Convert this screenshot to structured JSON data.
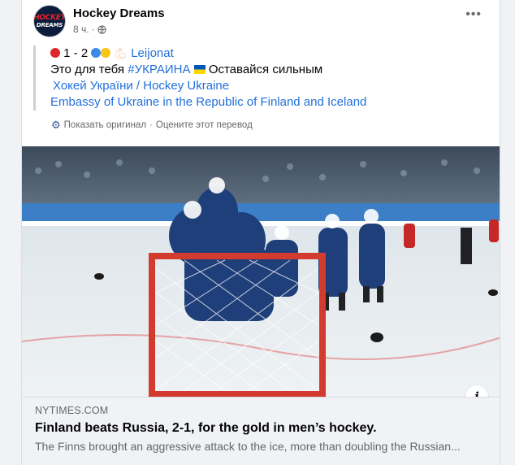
{
  "post": {
    "author": "Hockey Dreams",
    "time": "8 ч.",
    "separator": "·",
    "avatar_text_top": "HOCKEY",
    "avatar_text_bottom": "DREAMS",
    "more_icon": "•••"
  },
  "body": {
    "score_text": "1 - 2",
    "team_tag": "Leijonat",
    "line2_prefix": "Это для тебя",
    "hashtag": "#УКРАИНА",
    "line2_suffix": "Оставайся сильным",
    "mention1": "Хокей України / Hockey Ukraine",
    "mention2": "Embassy of Ukraine in the Republic of Finland and Iceland"
  },
  "translation": {
    "show_original": "Показать оригинал",
    "dot": "·",
    "rate": "Оцените этот перевод"
  },
  "link_preview": {
    "domain": "NYTIMES.COM",
    "title": "Finland beats Russia, 2-1, for the gold in men’s hockey.",
    "description": "The Finns brought an aggressive attack to the ice, more than doubling the Russian...",
    "info_icon": "i"
  },
  "colors": {
    "link": "#216fdb",
    "secondary_text": "#65676b",
    "card_bg": "#ffffff",
    "page_bg": "#f0f2f5",
    "finland_uniform": "#1f3f7a",
    "ice": "#e9eef1"
  },
  "icons": {
    "avatar": "hockey-dreams-logo",
    "audience": "globe-icon",
    "options": "more-options-icon",
    "translate": "gear-icon",
    "score_left": "red-circle-icon",
    "score_right": "blue-and-yellow-circle-icons",
    "flag": "ukraine-flag-icon",
    "muscle": "flexed-biceps-icon"
  }
}
